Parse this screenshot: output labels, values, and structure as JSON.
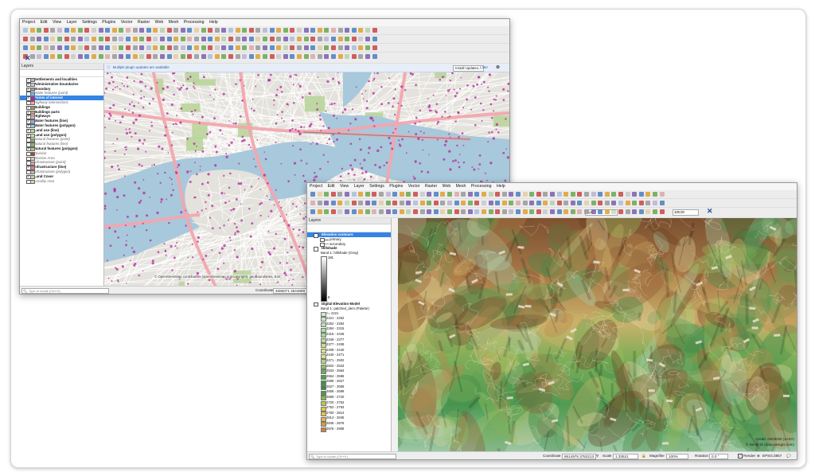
{
  "window1": {
    "menu": [
      "Project",
      "Edit",
      "View",
      "Layer",
      "Settings",
      "Plugins",
      "Vector",
      "Raster",
      "Web",
      "Mesh",
      "Processing",
      "Help"
    ],
    "layers_panel_title": "Layers",
    "layers": [
      {
        "label": "Settlements and localities",
        "bold": true,
        "checked": true
      },
      {
        "label": "Administrative boundaries",
        "bold": true,
        "checked": true
      },
      {
        "label": "Boundary",
        "bold": true,
        "checked": true
      },
      {
        "label": "Water features (point)",
        "italic": true,
        "checked": false
      },
      {
        "label": "Points of interest",
        "bold": true,
        "checked": true,
        "selected": true
      },
      {
        "label": "Highway intersections",
        "italic": true,
        "checked": false
      },
      {
        "label": "Buildings",
        "bold": true,
        "checked": true
      },
      {
        "label": "Buildings parts",
        "bold": true,
        "checked": true
      },
      {
        "label": "Highways",
        "bold": true,
        "checked": true
      },
      {
        "label": "Water features (line)",
        "bold": true,
        "checked": true
      },
      {
        "label": "Water features (polygon)",
        "bold": true,
        "checked": true
      },
      {
        "label": "Land use (line)",
        "bold": true,
        "checked": true
      },
      {
        "label": "Land use (polygon)",
        "bold": true,
        "checked": true
      },
      {
        "label": "Natural features (point)",
        "italic": true,
        "checked": false
      },
      {
        "label": "Natural features (line)",
        "italic": true,
        "checked": false
      },
      {
        "label": "Natural features (polygon)",
        "bold": true,
        "checked": true
      },
      {
        "label": "Division",
        "italic": true,
        "checked": false
      },
      {
        "label": "Division Area",
        "italic": true,
        "checked": false
      },
      {
        "label": "Infrastructure (point)",
        "italic": true,
        "checked": false
      },
      {
        "label": "Infrastructure (line)",
        "bold": true,
        "checked": true
      },
      {
        "label": "Infrastructure (polygon)",
        "italic": true,
        "checked": false
      },
      {
        "label": "Land Cover",
        "bold": true,
        "checked": true
      },
      {
        "label": "Locality Area",
        "italic": true,
        "checked": false
      }
    ],
    "plugin_notice": "Multiple plugin updates are available",
    "install_updates": "Install Updates...",
    "later": "Later",
    "attribution": "© OpenStreetMap contributors (openstreetmap.org/copyright), geoBoundaries, Esri",
    "locate_placeholder": "Type to locate (Ctrl+K)",
    "coordinate_label": "Coordinate",
    "coordinate_value": "4686071  3543899"
  },
  "window2": {
    "menu": [
      "Project",
      "Edit",
      "View",
      "Layer",
      "Settings",
      "Plugins",
      "Vector",
      "Raster",
      "Web",
      "Mesh",
      "Processing",
      "Help"
    ],
    "layers_panel_title": "Layers",
    "layers": [
      {
        "label": "Elevation contours",
        "bold": true,
        "selected": true
      },
      {
        "label": "primary",
        "sub": true
      },
      {
        "label": "secondary",
        "sub": true
      },
      {
        "label": "Hillshade",
        "bold": true
      },
      {
        "label": "Band 1: hillshade (Gray)",
        "sub": true
      }
    ],
    "gray_max": "181",
    "gray_min": "0",
    "dem_label": "Digital Elevation Model",
    "dem_band": "Band 1: patched_dem (Palette)",
    "legend": [
      {
        "label": "<= 2221",
        "color": "#cfe9c6"
      },
      {
        "label": "2221 - 2252",
        "color": "#c5e5bd"
      },
      {
        "label": "2252 - 2284",
        "color": "#badfb3"
      },
      {
        "label": "2284 - 2315",
        "color": "#b0d9a7"
      },
      {
        "label": "2315 - 2346",
        "color": "#a6d49c"
      },
      {
        "label": "2346 - 2377",
        "color": "#b8dc92"
      },
      {
        "label": "2377 - 2408",
        "color": "#c4de8a"
      },
      {
        "label": "2408 - 2440",
        "color": "#d0e084"
      },
      {
        "label": "2440 - 2471",
        "color": "#d8e084"
      },
      {
        "label": "2471 - 2502",
        "color": "#b5d27a"
      },
      {
        "label": "2502 - 2533",
        "color": "#8cc067"
      },
      {
        "label": "2533 - 2564",
        "color": "#6aae5a"
      },
      {
        "label": "2564 - 2596",
        "color": "#4f9f50"
      },
      {
        "label": "2596 - 2627",
        "color": "#3f9148"
      },
      {
        "label": "2627 - 2658",
        "color": "#3a8a45"
      },
      {
        "label": "2658 - 2689",
        "color": "#4f9a46"
      },
      {
        "label": "2689 - 2720",
        "color": "#8ab645"
      },
      {
        "label": "2720 - 2752",
        "color": "#b6c844"
      },
      {
        "label": "2752 - 2783",
        "color": "#d6cc44"
      },
      {
        "label": "2783 - 2814",
        "color": "#e4c247"
      },
      {
        "label": "2814 - 2845",
        "color": "#e4b248"
      },
      {
        "label": "2845 - 2876",
        "color": "#d69a44"
      },
      {
        "label": "2876 - 2908",
        "color": "#c68640"
      }
    ],
    "locate_placeholder": "Type to locate (Ctrl+K)",
    "coordinate_label": "Coordinate",
    "coordinate_value": "8614975  3782213",
    "scale_label": "Scale",
    "scale_value": "1:33521",
    "magnifier_label": "Magnifier",
    "magnifier_value": "100%",
    "rotation_label": "Rotation",
    "rotation_value": "0.0 °",
    "render_label": "Render",
    "crs_label": "EPSG:3857",
    "credit_line1": "Credit: AW3D30 (JAXA)",
    "credit_line2": "© NextGIS (data.nextgis.com)",
    "zoom_value": "1 px",
    "search_value": "100,00"
  },
  "colors": {
    "selection": "#3584e4",
    "water": "#a8c8dc",
    "road": "#f2a6ae",
    "poi": "#b4259b",
    "park": "#b9d59a"
  }
}
